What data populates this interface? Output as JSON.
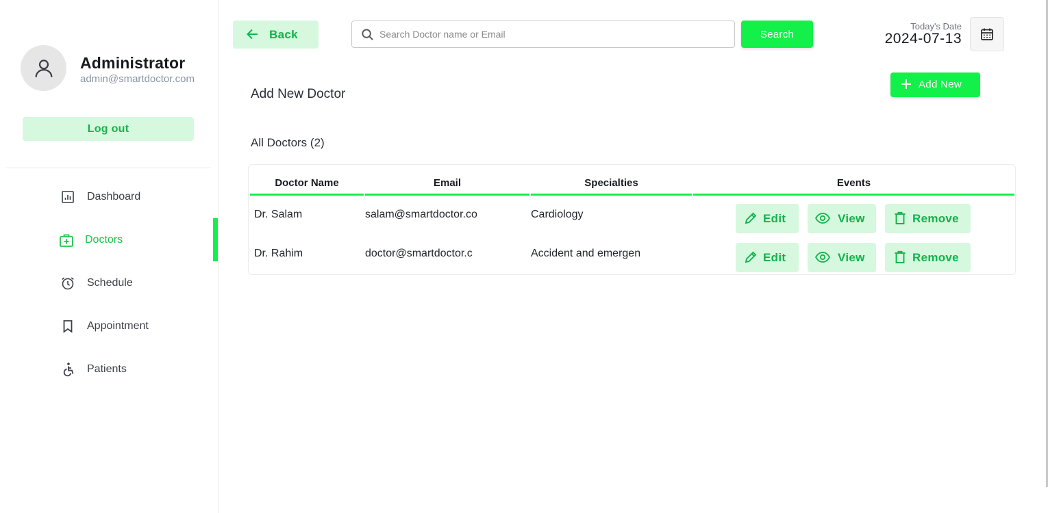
{
  "sidebar": {
    "profile": {
      "name": "Administrator",
      "email": "admin@smartdoctor.com",
      "avatar_icon": "user-icon"
    },
    "logout_label": "Log out",
    "nav": [
      {
        "label": "Dashboard",
        "icon": "dashboard-icon",
        "active": false
      },
      {
        "label": "Doctors",
        "icon": "doctor-kit-icon",
        "active": true
      },
      {
        "label": "Schedule",
        "icon": "alarm-clock-icon",
        "active": false
      },
      {
        "label": "Appointment",
        "icon": "bookmark-icon",
        "active": false
      },
      {
        "label": "Patients",
        "icon": "accessible-icon",
        "active": false
      }
    ]
  },
  "header": {
    "back_label": "Back",
    "search": {
      "placeholder": "Search Doctor name or Email",
      "value": "",
      "button_label": "Search"
    },
    "date_label": "Today's Date",
    "date_value": "2024-07-13"
  },
  "main": {
    "add_title": "Add New Doctor",
    "add_new_label": "Add New",
    "list_title": "All Doctors (2)",
    "table": {
      "columns": [
        "Doctor Name",
        "Email",
        "Specialties",
        "Events"
      ],
      "rows": [
        {
          "name": "Dr. Salam",
          "email": "salam@smartdoctor.co",
          "specialty": "Cardiology"
        },
        {
          "name": "Dr. Rahim",
          "email": "doctor@smartdoctor.c",
          "specialty": "Accident and emergen"
        }
      ],
      "actions": {
        "edit": "Edit",
        "view": "View",
        "remove": "Remove"
      }
    }
  },
  "colors": {
    "accent": "#14f04a",
    "accent_text": "#12b34a",
    "accent_soft": "#d6f8df"
  }
}
